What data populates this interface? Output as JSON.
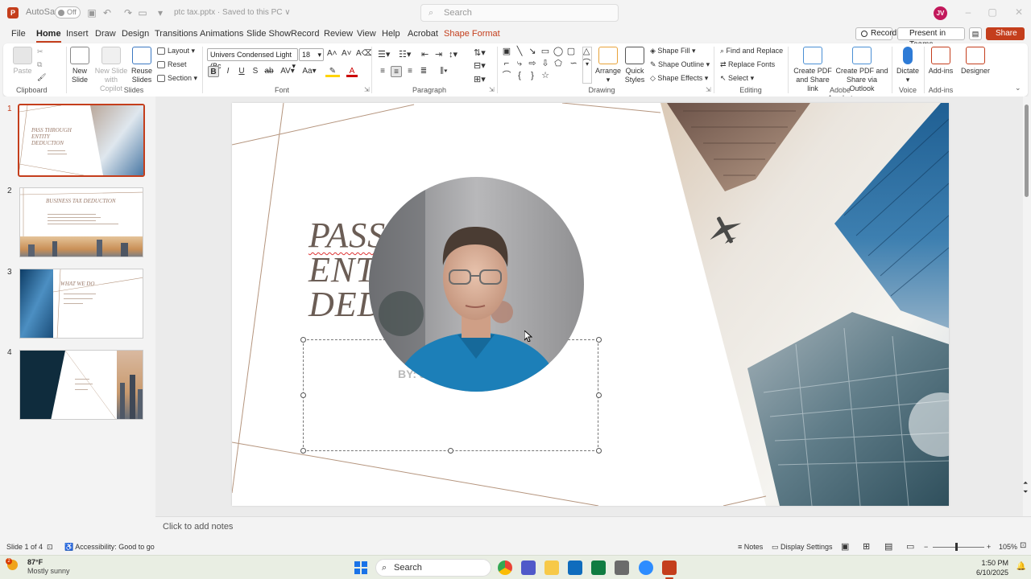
{
  "titlebar": {
    "autosave_label": "AutoSave",
    "autosave_state": "Off",
    "filename": "ptc tax.pptx  ·  Saved to this PC  ∨",
    "search_placeholder": "Search",
    "user_initials": "JV"
  },
  "menu": {
    "tabs": [
      "File",
      "Home",
      "Insert",
      "Draw",
      "Design",
      "Transitions",
      "Animations",
      "Slide Show",
      "Record",
      "Review",
      "View",
      "Help",
      "Acrobat",
      "Shape Format"
    ],
    "active_tab": "Home",
    "record_label": "Record",
    "present_label": "Present in Teams",
    "share_label": "Share"
  },
  "ribbon": {
    "clipboard": {
      "label": "Clipboard",
      "paste": "Paste"
    },
    "slides": {
      "label": "Slides",
      "new_slide": "New Slide",
      "new_slide_copilot": "New Slide with Copilot",
      "reuse_slides": "Reuse Slides",
      "layout": "Layout",
      "reset": "Reset",
      "section": "Section"
    },
    "font": {
      "label": "Font",
      "font_name": "Univers Condensed Light (Bc",
      "font_size": "18"
    },
    "paragraph": {
      "label": "Paragraph"
    },
    "drawing": {
      "label": "Drawing",
      "arrange": "Arrange",
      "quick_styles": "Quick Styles",
      "shape_fill": "Shape Fill",
      "shape_outline": "Shape Outline",
      "shape_effects": "Shape Effects"
    },
    "editing": {
      "label": "Editing",
      "find_replace": "Find and Replace",
      "replace_fonts": "Replace Fonts",
      "select": "Select"
    },
    "acrobat": {
      "label": "Adobe Acrobat",
      "create_pdf_share": "Create PDF and Share link",
      "create_pdf_outlook": "Create PDF and Share via Outlook"
    },
    "voice": {
      "label": "Voice",
      "dictate": "Dictate"
    },
    "addins": {
      "label": "Add-ins",
      "addins_btn": "Add-ins",
      "designer": "Designer"
    }
  },
  "thumbnails": [
    {
      "number": "1",
      "title": "PASS THROUGH ENTITY DEDUCTION",
      "selected": true
    },
    {
      "number": "2",
      "title": "BUSINESS TAX DEDUCTION",
      "selected": false
    },
    {
      "number": "3",
      "title": "WHAT WE DO",
      "selected": false
    },
    {
      "number": "4",
      "title": "",
      "selected": false
    }
  ],
  "slide": {
    "title_line1": "PASS",
    "title_line2": "ENT",
    "title_line3": "DED",
    "byline": "BY: J"
  },
  "notes_placeholder": "Click to add notes",
  "status": {
    "slide_count": "Slide 1 of 4",
    "accessibility": "Accessibility: Good to go",
    "notes": "Notes",
    "display_settings": "Display Settings",
    "zoom": "105%",
    "zoom_fraction": 0.45
  },
  "taskbar": {
    "weather_temp": "87°F",
    "weather_desc": "Mostly sunny",
    "weather_badge": "2",
    "search_label": "Search",
    "time": "1:50 PM",
    "date": "6/10/2025"
  },
  "colors": {
    "accent": "#c43e1c",
    "slide_lines": "#b5957e"
  }
}
